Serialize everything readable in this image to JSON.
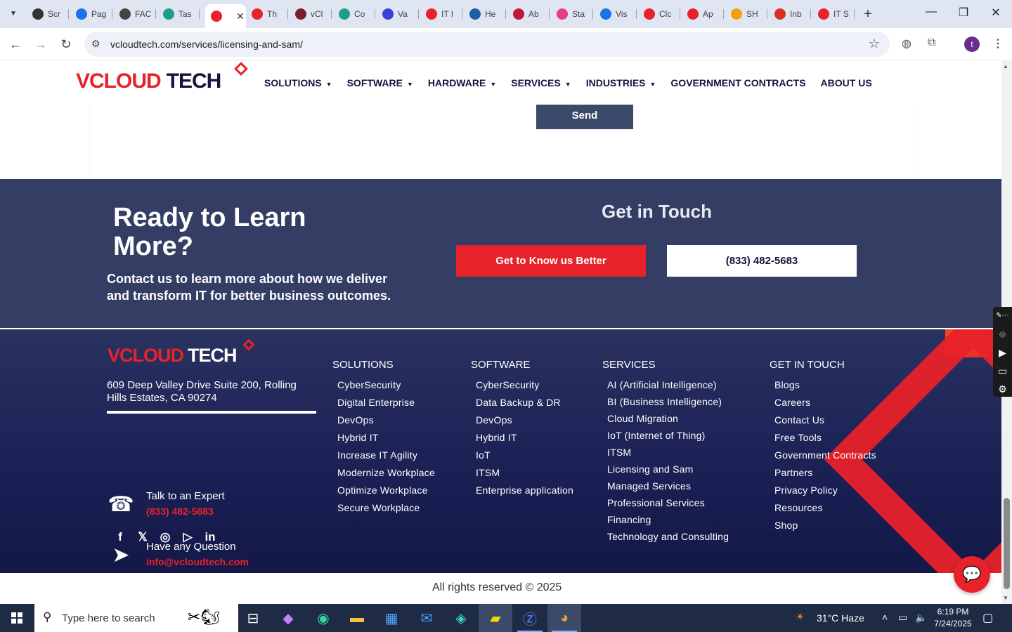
{
  "browser": {
    "tabs": [
      {
        "label": "Scr",
        "icon": "screencast-icon",
        "color": "#333"
      },
      {
        "label": "Pag",
        "icon": "page-icon",
        "color": "#1a73e8"
      },
      {
        "label": "FAC",
        "icon": "chatgpt-icon",
        "color": "#444"
      },
      {
        "label": "Tas",
        "icon": "tasks-icon",
        "color": "#1e9c8c"
      },
      {
        "label": "",
        "icon": "vcloud-icon",
        "color": "#e8222a",
        "active": true
      },
      {
        "label": "Th",
        "icon": "vcloud-icon",
        "color": "#e8222a"
      },
      {
        "label": "vCl",
        "icon": "v-icon",
        "color": "#7a1c2c"
      },
      {
        "label": "Co",
        "icon": "copilot-icon",
        "color": "#1e9c8c"
      },
      {
        "label": "Va",
        "icon": "x-icon",
        "color": "#3b3fd8"
      },
      {
        "label": "IT I",
        "icon": "vcloud-icon",
        "color": "#e8222a"
      },
      {
        "label": "He",
        "icon": "scale-icon",
        "color": "#1a5fa8"
      },
      {
        "label": "Ab",
        "icon": "ab-icon",
        "color": "#c0163b"
      },
      {
        "label": "Sta",
        "icon": "pen-icon",
        "color": "#e83a8a"
      },
      {
        "label": "Vis",
        "icon": "pulse-icon",
        "color": "#1a73e8"
      },
      {
        "label": "Clc",
        "icon": "curve-icon",
        "color": "#e8222a"
      },
      {
        "label": "Ap",
        "icon": "vcloud-icon",
        "color": "#e8222a"
      },
      {
        "label": "SH",
        "icon": "ring-icon",
        "color": "#f59e0b"
      },
      {
        "label": "Inb",
        "icon": "gmail-icon",
        "color": "#d93025"
      },
      {
        "label": "IT S",
        "icon": "vcloud-icon",
        "color": "#e8222a"
      }
    ],
    "url": "vcloudtech.com/services/licensing-and-sam/",
    "profile_initial": "t"
  },
  "header": {
    "logo": {
      "v": "V",
      "cloud": "CLOUD",
      "tech": "TECH"
    },
    "nav": [
      {
        "label": "SOLUTIONS",
        "dropdown": true
      },
      {
        "label": "SOFTWARE",
        "dropdown": true
      },
      {
        "label": "HARDWARE",
        "dropdown": true
      },
      {
        "label": "SERVICES",
        "dropdown": true
      },
      {
        "label": "INDUSTRIES",
        "dropdown": true
      },
      {
        "label": "GOVERNMENT CONTRACTS",
        "dropdown": false
      },
      {
        "label": "ABOUT US",
        "dropdown": false
      }
    ]
  },
  "form": {
    "send_label": "Send"
  },
  "cta": {
    "title": "Ready to Learn More?",
    "subtitle": "Contact us to learn more about how we deliver and transform IT for better business outcomes.",
    "get_in_touch": "Get in Touch",
    "primary_button": "Get to Know us Better",
    "phone_button": "(833) 482-5683"
  },
  "footer": {
    "address": "609 Deep Valley Drive Suite 200, Rolling Hills Estates, CA 90274",
    "expert_label": "Talk to an Expert",
    "expert_phone": "(833) 482-5683",
    "question_label": "Have any Question",
    "email": "info@vcloudtech.com",
    "socials": [
      "facebook-icon",
      "x-icon",
      "instagram-icon",
      "youtube-icon",
      "linkedin-icon"
    ],
    "columns": {
      "solutions": {
        "title": "SOLUTIONS",
        "items": [
          "CyberSecurity",
          "Digital Enterprise",
          "DevOps",
          "Hybrid IT",
          "Increase IT Agility",
          "Modernize Workplace",
          "Optimize Workplace",
          "Secure Workplace"
        ]
      },
      "software": {
        "title": "SOFTWARE",
        "items": [
          "CyberSecurity",
          "Data Backup & DR",
          "DevOps",
          "Hybrid IT",
          "IoT",
          "ITSM",
          "Enterprise application"
        ]
      },
      "services": {
        "title": "SERVICES",
        "items": [
          "AI (Artificial Intelligence)",
          "BI (Business Intelligence)",
          "Cloud Migration",
          "IoT (Internet of Thing)",
          "ITSM",
          "Licensing and Sam",
          "Managed Services",
          "Professional Services",
          "Financing",
          "Technology and Consulting"
        ]
      },
      "get_in_touch": {
        "title": "GET IN TOUCH",
        "items": [
          "Blogs",
          "Careers",
          "Contact Us",
          "Free Tools",
          "Government Contracts",
          "Partners",
          "Privacy Policy",
          "Resources",
          "Shop"
        ]
      }
    },
    "copyright": "All rights reserved © 2025"
  },
  "taskbar": {
    "search_placeholder": "Type here to search",
    "weather": "31°C  Haze",
    "time": "6:19 PM",
    "date": "7/24/2025"
  },
  "colors": {
    "brand_red": "#e8222a",
    "brand_navy": "#14163f",
    "cta_bg": "#343d63"
  }
}
